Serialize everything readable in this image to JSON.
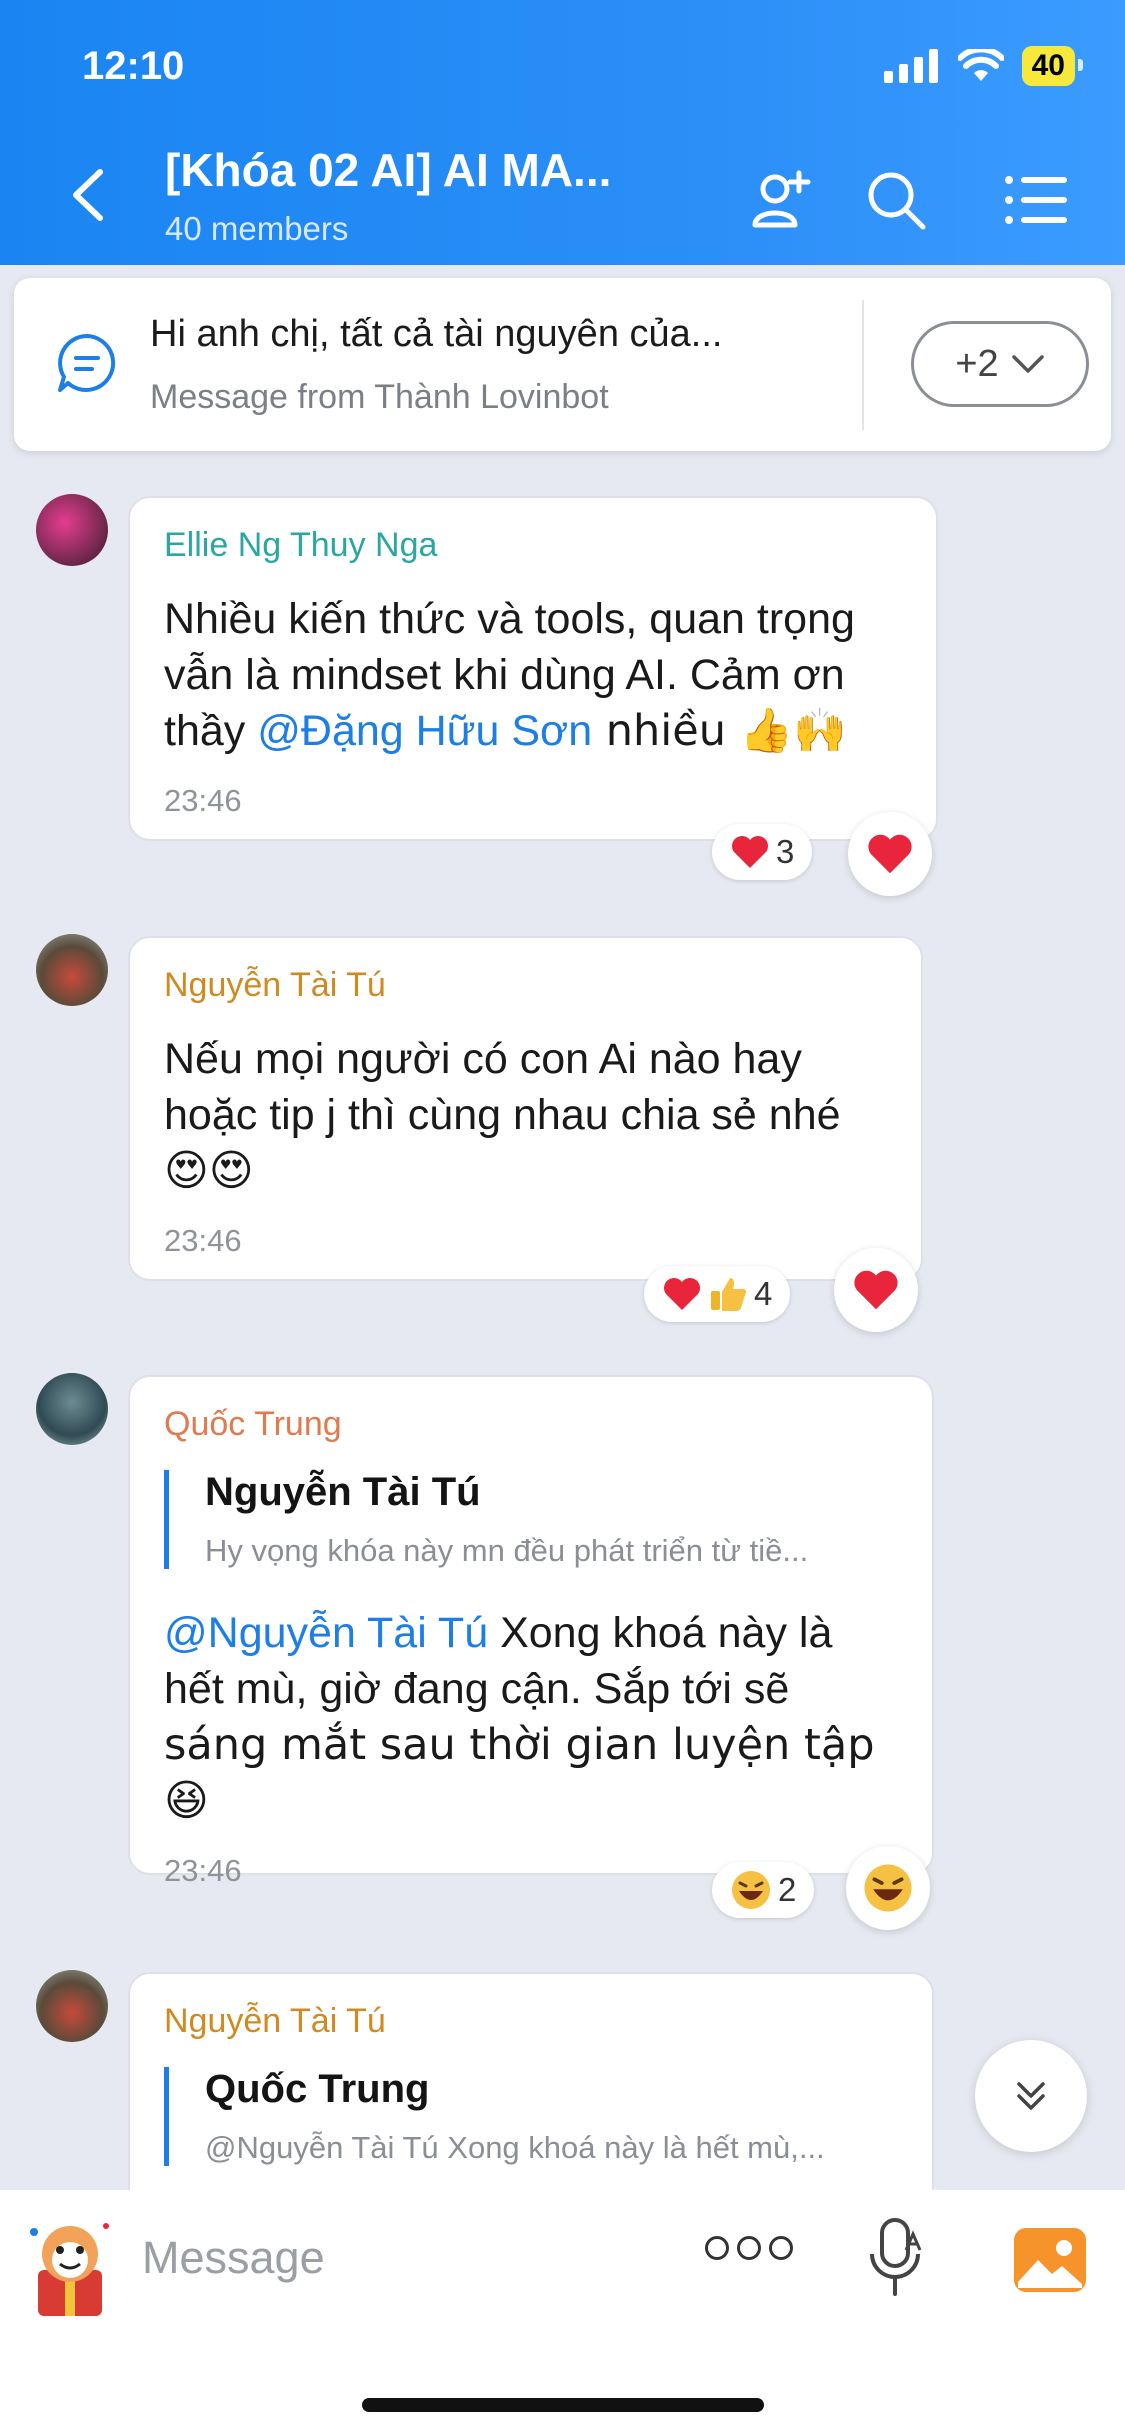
{
  "status": {
    "time": "12:10",
    "battery": "40"
  },
  "header": {
    "title": "[Khóa 02 AI] AI MA...",
    "subtitle": "40 members"
  },
  "pinned": {
    "title": "Hi anh chị, tất cả tài nguyên của...",
    "subtitle": "Message from Thành Lovinbot",
    "more": "+2"
  },
  "messages": [
    {
      "sender": "Ellie Ng Thuy Nga",
      "text_1": "Nhiều kiến thức và tools, quan trọng",
      "text_2": "vẫn là mindset khi dùng AI. Cảm ơn",
      "text_3a": "thầy ",
      "mention": "@Đặng Hữu Sơn",
      "text_3b": " nhiều 👍🙌",
      "time": "23:46",
      "reaction_count": "3"
    },
    {
      "sender": "Nguyễn Tài Tú",
      "text_1": "Nếu mọi người có con Ai nào hay",
      "text_2": "hoặc tip j thì cùng nhau chia sẻ nhé",
      "text_3": "😍😍",
      "time": "23:46",
      "reaction_count": "4"
    },
    {
      "sender": "Quốc Trung",
      "quote_name": "Nguyễn Tài Tú",
      "quote_text": "Hy vọng khóa này mn đều phát triển từ tiề...",
      "mention": "@Nguyễn Tài Tú",
      "text_1": " Xong khoá này là",
      "text_2": "hết mù, giờ đang cận. Sắp tới sẽ",
      "text_3": "sáng mắt sau thời gian luyện tập 😆",
      "time": "23:46",
      "reaction_count": "2"
    },
    {
      "sender": "Nguyễn Tài Tú",
      "quote_name": "Quốc Trung",
      "quote_text": "@Nguyễn Tài Tú Xong khoá này là hết mù,..."
    }
  ],
  "composer": {
    "placeholder": "Message"
  },
  "colors": {
    "header": "#1a85f2",
    "mention": "#1d7ee6",
    "sender_teal": "#2aa7a0",
    "sender_orange": "#d08a22",
    "sender_red": "#e07a4f",
    "heart": "#e8253a"
  },
  "icons": [
    "back-chevron-icon",
    "add-member-icon",
    "search-icon",
    "menu-icon",
    "chat-bubble-icon",
    "chevron-down-icon",
    "heart-icon",
    "thumbs-up-icon",
    "laugh-icon",
    "double-chevron-down-icon",
    "sticker-icon",
    "more-icon",
    "mic-icon",
    "image-icon"
  ]
}
